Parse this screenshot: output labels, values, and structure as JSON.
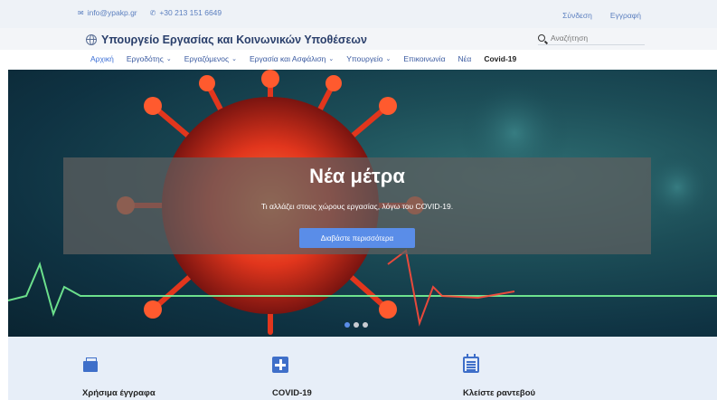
{
  "topbar": {
    "email": "info@ypakp.gr",
    "phone": "+30 213 151 6649",
    "login": "Σύνδεση",
    "register": "Εγγραφή"
  },
  "header": {
    "title": "Υπουργείο Εργασίας και Κοινωνικών Υποθέσεων",
    "search_placeholder": "Αναζήτηση"
  },
  "nav": {
    "items": [
      {
        "label": "Αρχική",
        "dropdown": false
      },
      {
        "label": "Εργοδότης",
        "dropdown": true
      },
      {
        "label": "Εργαζόμενος",
        "dropdown": true
      },
      {
        "label": "Εργασία και Ασφάλιση",
        "dropdown": true
      },
      {
        "label": "Υπουργείο",
        "dropdown": true
      },
      {
        "label": "Επικοινωνία",
        "dropdown": false
      },
      {
        "label": "Νέα",
        "dropdown": false
      },
      {
        "label": "Covid-19",
        "dropdown": false
      }
    ]
  },
  "hero": {
    "title": "Νέα μέτρα",
    "subtitle": "Τι αλλάζει στους χώρους εργασίας, λόγω του COVID-19.",
    "cta": "Διαβάστε περισσότερα",
    "slides": 3,
    "active_slide": 1
  },
  "services": [
    {
      "label": "Χρήσιμα έγγραφα",
      "icon": "documents-icon"
    },
    {
      "label": "COVID-19",
      "icon": "plus-icon"
    },
    {
      "label": "Κλείστε ραντεβού",
      "icon": "calendar-icon"
    }
  ],
  "colors": {
    "accent": "#5a8de8",
    "brand": "#2a3f6b",
    "link": "#3a5aa0",
    "services_bg": "#e7eef8"
  }
}
